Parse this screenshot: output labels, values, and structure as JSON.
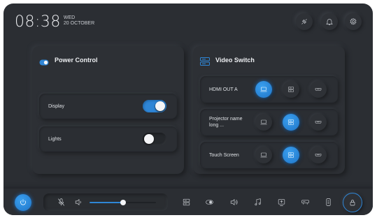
{
  "clock": {
    "time": "08:38",
    "weekday": "WED",
    "date": "20 OCTOBER"
  },
  "header": {
    "icons": [
      "unplug-icon",
      "bell-icon",
      "gear-icon"
    ]
  },
  "power_control": {
    "title": "Power Control",
    "items": [
      {
        "label": "Display",
        "on": true
      },
      {
        "label": "Lights",
        "on": false
      }
    ]
  },
  "video_switch": {
    "title": "Video Switch",
    "rows": [
      {
        "label": "HDMI OUT A",
        "active": 0
      },
      {
        "label": "Projector name long ...",
        "active": 1
      },
      {
        "label": "Touch Screen",
        "active": 1
      }
    ],
    "source_icons": [
      "laptop-icon",
      "media-player-icon",
      "hdmi-icon"
    ]
  },
  "bottom_bar": {
    "volume_level": 0.5,
    "icons": [
      "server-icon",
      "toggle-icon",
      "speaker-icon",
      "music-icon",
      "screen-share-icon",
      "projector-icon",
      "remote-icon",
      "lock-icon"
    ]
  },
  "colors": {
    "accent": "#2f86d6",
    "background": "#2b2e33"
  }
}
